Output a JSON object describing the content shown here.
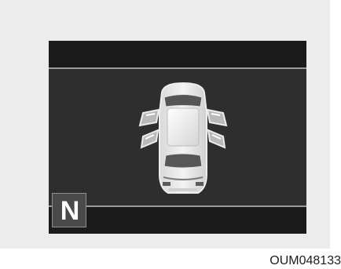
{
  "cluster": {
    "gear_indicator": "N",
    "status": {
      "front_left_door": "open",
      "front_right_door": "open",
      "rear_left_door": "open",
      "rear_right_door": "open",
      "hood": "closed",
      "trunk": "closed"
    }
  },
  "caption": {
    "code": "OUM048133"
  },
  "icons": {
    "vehicle": "car-top-view-icon"
  }
}
